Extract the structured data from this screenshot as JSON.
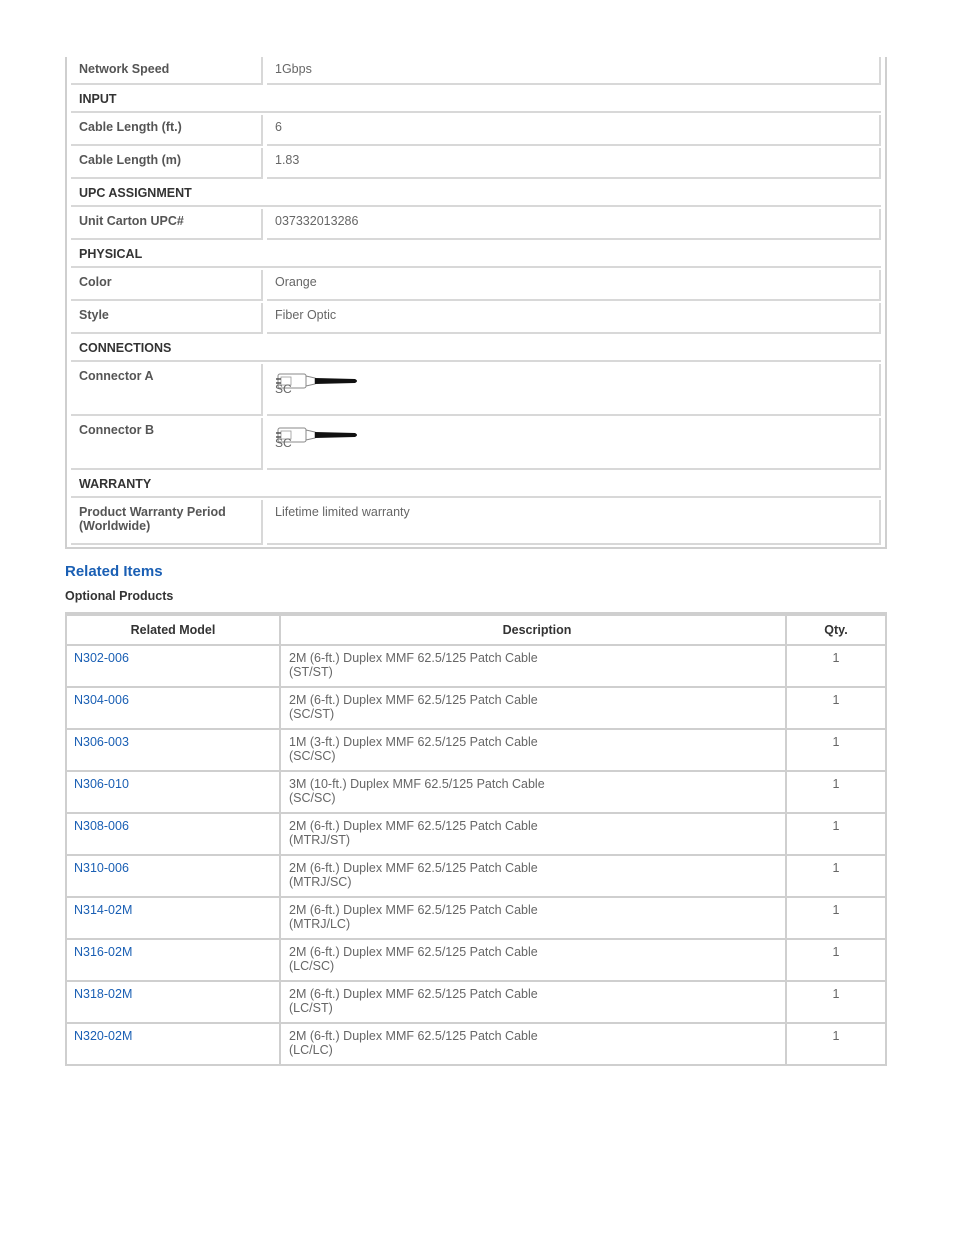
{
  "specs": {
    "network_speed": {
      "label": "Network Speed",
      "value": "1Gbps"
    },
    "input_header": "INPUT",
    "cable_length_ft": {
      "label": "Cable Length (ft.)",
      "value": "6"
    },
    "cable_length_m": {
      "label": "Cable Length (m)",
      "value": "1.83"
    },
    "upc_header": "UPC ASSIGNMENT",
    "unit_carton_upc": {
      "label": "Unit Carton UPC#",
      "value": "037332013286"
    },
    "physical_header": "PHYSICAL",
    "color": {
      "label": "Color",
      "value": "Orange"
    },
    "style": {
      "label": "Style",
      "value": "Fiber Optic"
    },
    "connections_header": "CONNECTIONS",
    "connector_a": {
      "label": "Connector A",
      "value": "SC"
    },
    "connector_b": {
      "label": "Connector B",
      "value": "SC"
    },
    "warranty_header": "WARRANTY",
    "warranty_period": {
      "label": "Product Warranty Period (Worldwide)",
      "value": "Lifetime limited warranty"
    }
  },
  "related": {
    "title": "Related Items",
    "subtitle": "Optional Products",
    "headers": {
      "model": "Related Model",
      "description": "Description",
      "qty": "Qty."
    },
    "rows": [
      {
        "model": "N302-006",
        "desc1": "2M (6-ft.) Duplex MMF 62.5/125 Patch Cable",
        "desc2": "(ST/ST)",
        "qty": "1"
      },
      {
        "model": "N304-006",
        "desc1": "2M (6-ft.) Duplex MMF 62.5/125 Patch Cable",
        "desc2": "(SC/ST)",
        "qty": "1"
      },
      {
        "model": "N306-003",
        "desc1": "1M (3-ft.) Duplex MMF 62.5/125 Patch Cable",
        "desc2": "(SC/SC)",
        "qty": "1"
      },
      {
        "model": "N306-010",
        "desc1": "3M (10-ft.) Duplex MMF 62.5/125 Patch Cable",
        "desc2": "(SC/SC)",
        "qty": "1"
      },
      {
        "model": "N308-006",
        "desc1": "2M (6-ft.) Duplex MMF 62.5/125 Patch Cable",
        "desc2": "(MTRJ/ST)",
        "qty": "1"
      },
      {
        "model": "N310-006",
        "desc1": "2M (6-ft.) Duplex MMF 62.5/125 Patch Cable",
        "desc2": "(MTRJ/SC)",
        "qty": "1"
      },
      {
        "model": "N314-02M",
        "desc1": "2M (6-ft.) Duplex MMF 62.5/125 Patch Cable",
        "desc2": "(MTRJ/LC)",
        "qty": "1"
      },
      {
        "model": "N316-02M",
        "desc1": "2M (6-ft.) Duplex MMF 62.5/125 Patch Cable",
        "desc2": "(LC/SC)",
        "qty": "1"
      },
      {
        "model": "N318-02M",
        "desc1": "2M (6-ft.) Duplex MMF 62.5/125 Patch Cable",
        "desc2": "(LC/ST)",
        "qty": "1"
      },
      {
        "model": "N320-02M",
        "desc1": "2M (6-ft.) Duplex MMF 62.5/125 Patch Cable",
        "desc2": "(LC/LC)",
        "qty": "1"
      }
    ]
  },
  "colors": {
    "link": "#1a5fb4",
    "border": "#cfcfcf"
  }
}
